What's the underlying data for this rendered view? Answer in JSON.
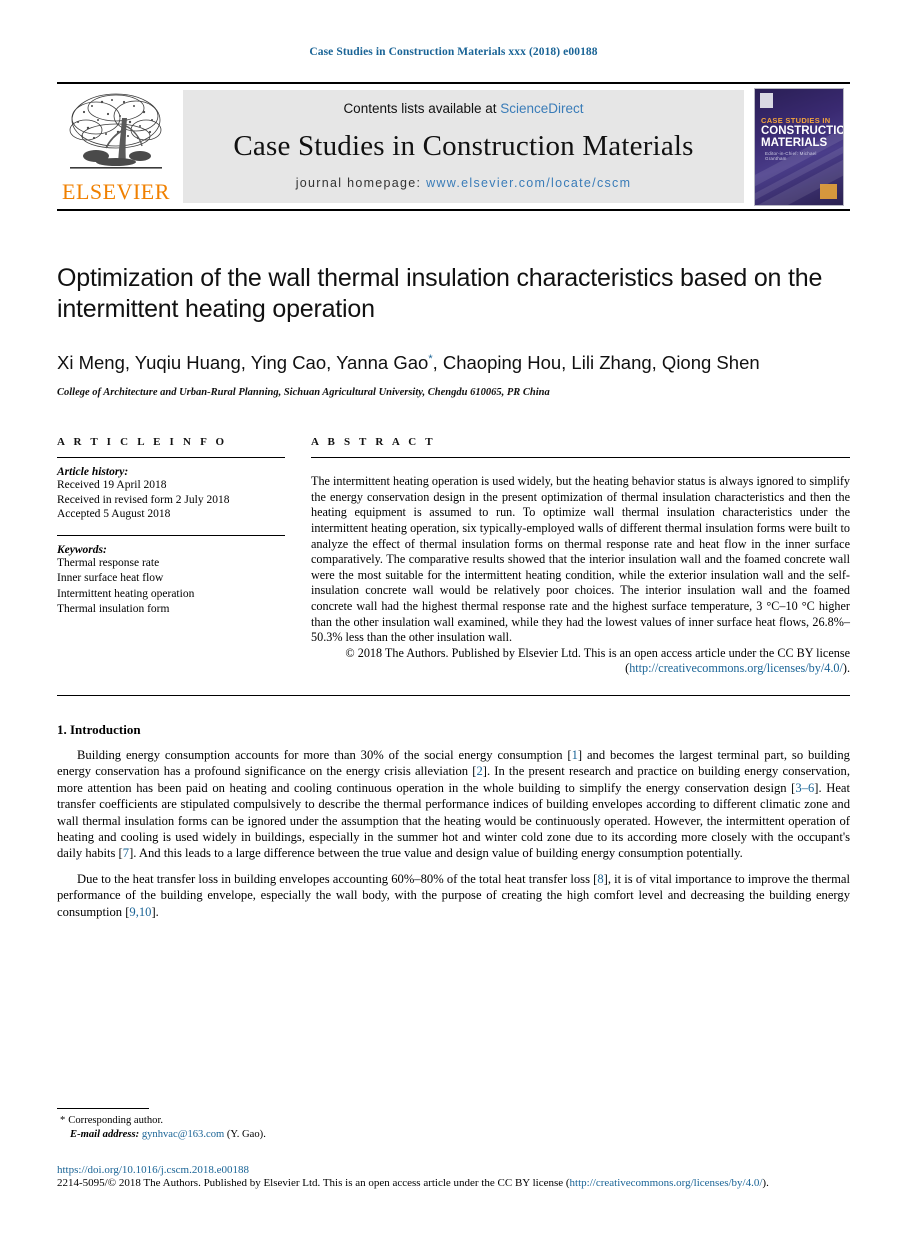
{
  "running_head": "Case Studies in Construction Materials xxx (2018) e00188",
  "banner": {
    "publisher_logo_text": "ELSEVIER",
    "contents_prefix": "Contents lists available at ",
    "contents_link": "ScienceDirect",
    "journal_title": "Case Studies in Construction Materials",
    "homepage_prefix": "journal homepage: ",
    "homepage_link": "www.elsevier.com/locate/cscm",
    "cover": {
      "line1": "CASE STUDIES IN",
      "line2": "CONSTRUCTION MATERIALS",
      "line3": "Editor-in-Chief: Michael Grantham"
    }
  },
  "title": "Optimization of the wall thermal insulation characteristics based on the intermittent heating operation",
  "authors": "Xi Meng, Yuqiu Huang, Ying Cao, Yanna Gao",
  "authors_corresponding_marker": "*",
  "authors_rest": ", Chaoping Hou, Lili Zhang, Qiong Shen",
  "affiliation": "College of Architecture and Urban-Rural Planning, Sichuan Agricultural University, Chengdu 610065, PR China",
  "article_info": {
    "label": "A R T I C L E  I N F O",
    "history_label": "Article history:",
    "history": [
      "Received 19 April 2018",
      "Received in revised form 2 July 2018",
      "Accepted 5 August 2018"
    ],
    "keywords_label": "Keywords:",
    "keywords": [
      "Thermal response rate",
      "Inner surface heat flow",
      "Intermittent heating operation",
      "Thermal insulation form"
    ]
  },
  "abstract": {
    "label": "A B S T R A C T",
    "text": "The intermittent heating operation is used widely, but the heating behavior status is always ignored to simplify the energy conservation design in the present optimization of thermal insulation characteristics and then the heating equipment is assumed to run. To optimize wall thermal insulation characteristics under the intermittent heating operation, six typically-employed walls of different thermal insulation forms were built to analyze the effect of thermal insulation forms on thermal response rate and heat flow in the inner surface comparatively. The comparative results showed that the interior insulation wall and the foamed concrete wall were the most suitable for the intermittent heating condition, while the exterior insulation wall and the self-insulation concrete wall would be relatively poor choices. The interior insulation wall and the foamed concrete wall had the highest thermal response rate and the highest surface temperature, 3 °C–10 °C higher than the other insulation wall examined, while they had the lowest values of inner surface heat flows, 26.8%–50.3% less than the other insulation wall.",
    "copyright_pre": "© 2018 The Authors. Published by Elsevier Ltd. This is an open access article under the CC BY license (",
    "copyright_link": "http://creativecommons.org/licenses/by/4.0/",
    "copyright_post": ")."
  },
  "body": {
    "section1_heading": "1. Introduction",
    "p1_a": "Building energy consumption accounts for more than 30% of the social energy consumption [",
    "p1_r1": "1",
    "p1_b": "] and becomes the largest terminal part, so building energy conservation has a profound significance on the energy crisis alleviation [",
    "p1_r2": "2",
    "p1_c": "]. In the present research and practice on building energy conservation, more attention has been paid on heating and cooling continuous operation in the whole building to simplify the energy conservation design [",
    "p1_r3": "3–6",
    "p1_d": "]. Heat transfer coefficients are stipulated compulsively to describe the thermal performance indices of building envelopes according to different climatic zone and wall thermal insulation forms can be ignored under the assumption that the heating would be continuously operated. However, the intermittent operation of heating and cooling is used widely in buildings, especially in the summer hot and winter cold zone due to its according more closely with the occupant's daily habits [",
    "p1_r4": "7",
    "p1_e": "]. And this leads to a large difference between the true value and design value of building energy consumption potentially.",
    "p2_a": "Due to the heat transfer loss in building envelopes accounting 60%–80% of the total heat transfer loss [",
    "p2_r1": "8",
    "p2_b": "], it is of vital importance to improve the thermal performance of the building envelope, especially the wall body, with the purpose of creating the high comfort level and decreasing the building energy consumption [",
    "p2_r2": "9,10",
    "p2_c": "]."
  },
  "footer": {
    "corresponding_star": "*",
    "corresponding_text": "Corresponding author.",
    "email_label": "E-mail address:",
    "email": "gynhvac@163.com",
    "email_suffix": "(Y. Gao).",
    "doi": "https://doi.org/10.1016/j.cscm.2018.e00188",
    "issn_pre": "2214-5095/© 2018 The Authors. Published by Elsevier Ltd. This is an open access article under the CC BY license (",
    "issn_link": "http://creativecommons.org/licenses/by/4.0/",
    "issn_post": ")."
  },
  "colors": {
    "link_blue": "#1a6496",
    "banner_link_blue": "#3a7cb8",
    "elsevier_orange": "#f08000",
    "banner_bg": "#e6e6e6"
  }
}
